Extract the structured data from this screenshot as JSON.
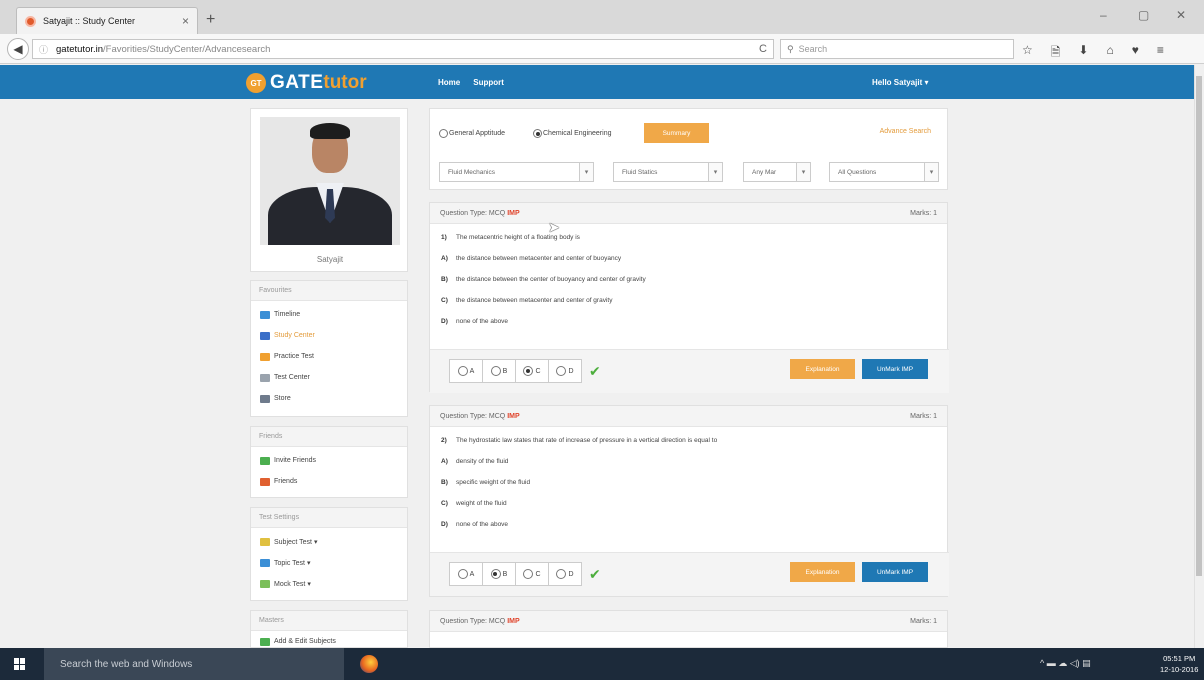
{
  "browser": {
    "tab_title": "Satyajit :: Study Center",
    "tab_close": "×",
    "new_tab": "+",
    "url_host": "gatetutor.in",
    "url_path": "/Favorities/StudyCenter/Advancesearch",
    "search_placeholder": "Search",
    "window_controls": [
      "–",
      "▢",
      "✕"
    ],
    "toolbar_icons": [
      "☆",
      "🗎",
      "⬇",
      "⌂",
      "♥",
      "≡"
    ]
  },
  "site": {
    "logo_badge": "GT",
    "logo_gate": "GATE",
    "logo_tutor": "tutor",
    "nav": [
      "Home",
      "Support"
    ],
    "greeting": "Hello Satyajit ▾"
  },
  "profile": {
    "name": "Satyajit"
  },
  "sidebar": {
    "favourites": {
      "title": "Favourites",
      "items": [
        {
          "label": "Timeline",
          "color": "#3b8fd6"
        },
        {
          "label": "Study Center",
          "color": "#3b6fc8"
        },
        {
          "label": "Practice Test",
          "color": "#f0a030"
        },
        {
          "label": "Test Center",
          "color": "#9aa3ad"
        },
        {
          "label": "Store",
          "color": "#6f7b8c"
        }
      ]
    },
    "friends": {
      "title": "Friends",
      "items": [
        {
          "label": "Invite Friends",
          "color": "#4caf50"
        },
        {
          "label": "Friends",
          "color": "#e06030"
        }
      ]
    },
    "test_settings": {
      "title": "Test Settings",
      "items": [
        {
          "label": "Subject Test ▾",
          "color": "#e0c040"
        },
        {
          "label": "Topic Test ▾",
          "color": "#3b8fd6"
        },
        {
          "label": "Mock Test ▾",
          "color": "#7bbf5a"
        }
      ]
    },
    "masters": {
      "title": "Masters",
      "items": [
        {
          "label": "Add & Edit Subjects",
          "color": "#4caf50"
        }
      ]
    }
  },
  "filters": {
    "options": [
      "General Apptitude",
      "Chemical Engineering"
    ],
    "summary_button": "Summary",
    "advance_search": "Advance Search",
    "selects": [
      "Fluid Mechanics",
      "Fluid Statics",
      "Any Mar",
      "All Questions"
    ]
  },
  "questions": [
    {
      "type_label": "Question Type: MCQ",
      "imp": "IMP",
      "marks": "Marks: 1",
      "number": "1)",
      "text": "The metacentric height of a floating body is",
      "options": [
        {
          "label": "A)",
          "text": "the distance between metacenter and center of buoyancy"
        },
        {
          "label": "B)",
          "text": "the distance between the center of buoyancy and center of gravity"
        },
        {
          "label": "C)",
          "text": "the distance between metacenter and center of gravity"
        },
        {
          "label": "D)",
          "text": "none of the above"
        }
      ],
      "answers": [
        "A",
        "B",
        "C",
        "D"
      ],
      "selected": "C",
      "explanation_button": "Explanation",
      "unmark_button": "UnMark IMP"
    },
    {
      "type_label": "Question Type: MCQ",
      "imp": "IMP",
      "marks": "Marks: 1",
      "number": "2)",
      "text": "The hydrostatic law states that rate of increase of pressure in a vertical direction is equal to",
      "options": [
        {
          "label": "A)",
          "text": "density of the fluid"
        },
        {
          "label": "B)",
          "text": "specific weight of the fluid"
        },
        {
          "label": "C)",
          "text": "weight of the fluid"
        },
        {
          "label": "D)",
          "text": "none of the above"
        }
      ],
      "answers": [
        "A",
        "B",
        "C",
        "D"
      ],
      "selected": "B",
      "explanation_button": "Explanation",
      "unmark_button": "UnMark IMP"
    },
    {
      "type_label": "Question Type: MCQ",
      "imp": "IMP",
      "marks": "Marks: 1"
    }
  ],
  "taskbar": {
    "search_placeholder": "Search the web and Windows",
    "tray": "^ ▬ ☁ ◁) ▤",
    "time": "05:51 PM",
    "date": "12-10-2016"
  }
}
